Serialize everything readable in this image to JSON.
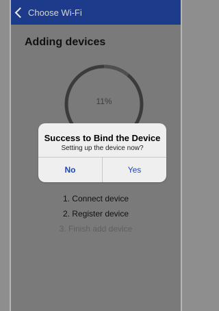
{
  "nav": {
    "back_label": "Choose Wi-Fi",
    "bar_color": "#1e3a8a"
  },
  "page": {
    "title": "Adding devices"
  },
  "progress": {
    "percent_label": "11%",
    "value": 0.11,
    "track_color": "#3b3b3b",
    "indicator_color": "#4f4f4f"
  },
  "steps": [
    {
      "label": "1. Connect device",
      "active": true
    },
    {
      "label": "2. Register device",
      "active": true
    },
    {
      "label": "3. Finish add device",
      "active": false
    }
  ],
  "dialog": {
    "title": "Success to Bind the Device",
    "message": "Setting up the device now?",
    "buttons": {
      "no": "No",
      "yes": "Yes"
    },
    "accent_color": "#1f46b4"
  }
}
